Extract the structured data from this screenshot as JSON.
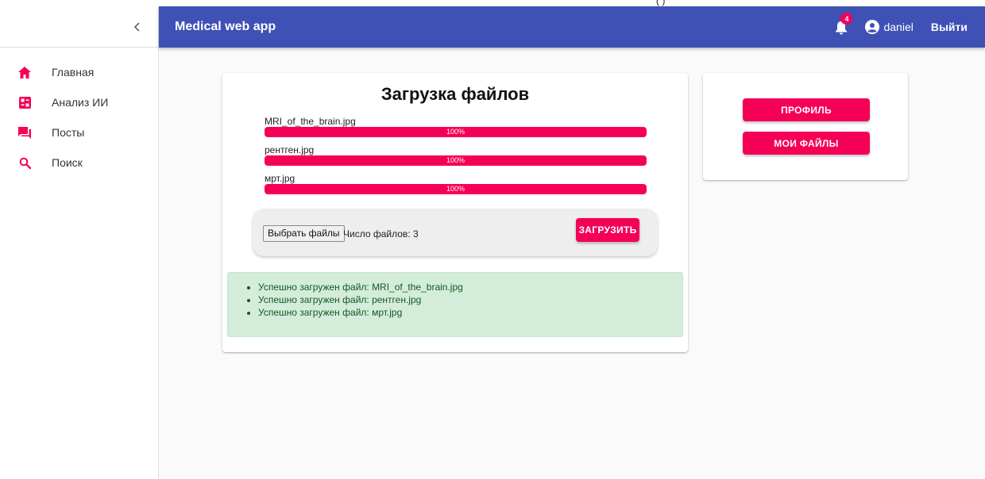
{
  "app": {
    "title": "Medical web app",
    "notifications_count": "4",
    "username": "daniel",
    "logout_label": "Выйти",
    "clipped_top_text": "(                              )"
  },
  "sidebar": {
    "items": [
      {
        "label": "Главная",
        "icon": "home-icon"
      },
      {
        "label": "Анализ ИИ",
        "icon": "dashboard-icon"
      },
      {
        "label": "Посты",
        "icon": "forum-icon"
      },
      {
        "label": "Поиск",
        "icon": "search-icon"
      }
    ]
  },
  "upload": {
    "heading": "Загрузка файлов",
    "files": [
      {
        "name": "MRI_of_the_brain.jpg",
        "progress_label": "100%",
        "progress": 1.0
      },
      {
        "name": "рентген.jpg",
        "progress_label": "100%",
        "progress": 1.0
      },
      {
        "name": "мрт.jpg",
        "progress_label": "100%",
        "progress": 1.0
      }
    ],
    "choose_files_label": "Выбрать файлы",
    "files_count_label": "Число файлов: 3",
    "upload_button_label": "ЗАГРУЗИТЬ",
    "messages": [
      "Успешно загружен файл: MRI_of_the_brain.jpg",
      "Успешно загружен файл: рентген.jpg",
      "Успешно загружен файл: мрт.jpg"
    ]
  },
  "side_panel": {
    "profile_label": "ПРОФИЛЬ",
    "my_files_label": "МОИ ФАЙЛЫ"
  },
  "colors": {
    "primary": "#3f51b5",
    "accent": "#f50057",
    "success_bg": "#d4edda",
    "success_text": "#155724"
  }
}
